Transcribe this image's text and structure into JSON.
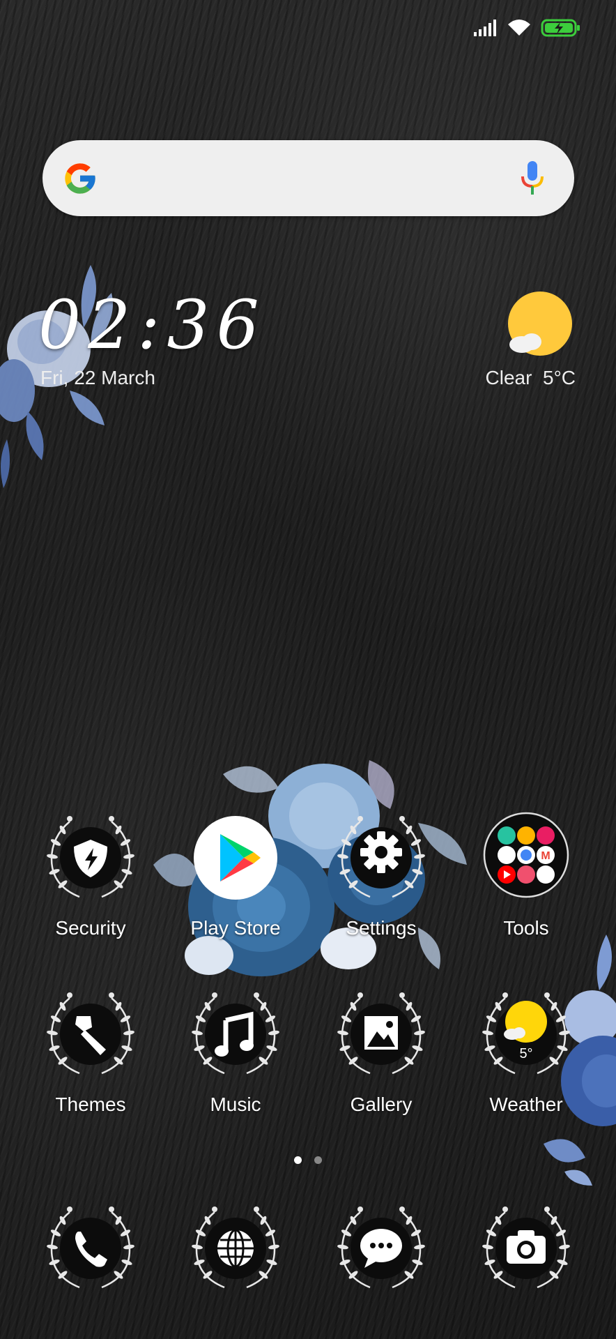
{
  "clock": {
    "time": "02:36",
    "date": "Fri, 22 March"
  },
  "weather_widget": {
    "condition": "Clear",
    "temperature": "5°C",
    "icon": "sun-cloud-icon"
  },
  "search": {
    "icon": "google-logo-icon",
    "mic_icon": "mic-icon"
  },
  "status_bar": {
    "icons": [
      "signal-icon",
      "wifi-icon",
      "battery-charging-icon"
    ],
    "battery_color": "#3ccd3c"
  },
  "apps_row1": [
    {
      "label": "Security",
      "icon": "shield-bolt-icon"
    },
    {
      "label": "Play Store",
      "icon": "play-store-icon"
    },
    {
      "label": "Settings",
      "icon": "gear-icon"
    },
    {
      "label": "Tools",
      "icon": "folder-icon"
    }
  ],
  "apps_row2": [
    {
      "label": "Themes",
      "icon": "paintbrush-icon"
    },
    {
      "label": "Music",
      "icon": "music-note-icon"
    },
    {
      "label": "Gallery",
      "icon": "image-icon"
    },
    {
      "label": "Weather",
      "icon": "weather-icon",
      "temp": "5°"
    }
  ],
  "dock": [
    {
      "icon": "phone-icon"
    },
    {
      "icon": "globe-icon"
    },
    {
      "icon": "message-icon"
    },
    {
      "icon": "camera-icon"
    }
  ],
  "page_indicator": {
    "pages": 2,
    "current": 1
  }
}
